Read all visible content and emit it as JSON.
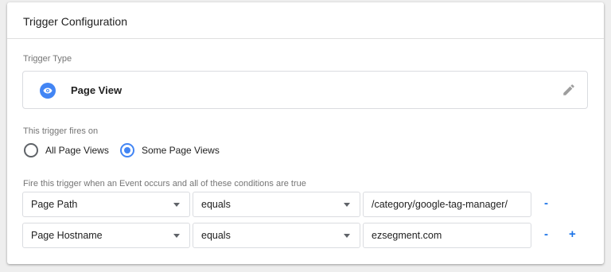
{
  "card": {
    "title": "Trigger Configuration"
  },
  "trigger_type": {
    "label": "Trigger Type",
    "name": "Page View",
    "icon": "eye-icon",
    "accent": "#4285f4"
  },
  "fires_on": {
    "label": "This trigger fires on",
    "options": [
      {
        "label": "All Page Views",
        "checked": false
      },
      {
        "label": "Some Page Views",
        "checked": true
      }
    ]
  },
  "conditions": {
    "label": "Fire this trigger when an Event occurs and all of these conditions are true",
    "rows": [
      {
        "variable": "Page Path",
        "operator": "equals",
        "value": "/category/google-tag-manager/",
        "remove": "-"
      },
      {
        "variable": "Page Hostname",
        "operator": "equals",
        "value": "ezsegment.com",
        "remove": "-",
        "add": "+"
      }
    ]
  }
}
